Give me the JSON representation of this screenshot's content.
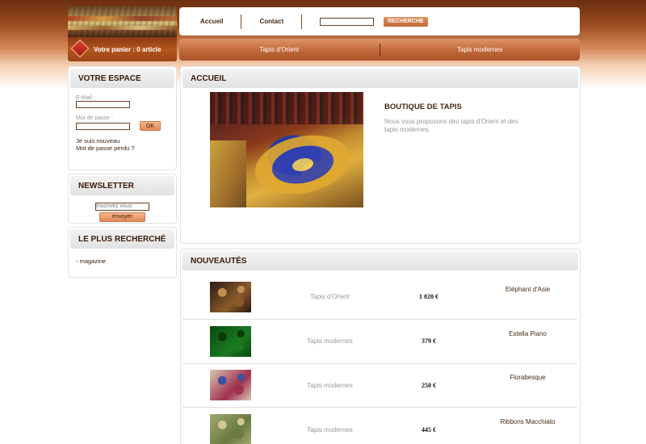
{
  "header": {
    "cart_text": "Votre panier : 0 article",
    "nav": [
      {
        "label": "Accueil"
      },
      {
        "label": "Contact"
      }
    ],
    "search": {
      "value": "",
      "button_label": "RECHERCHE"
    },
    "categories": [
      {
        "label": "Tapis d'Orient"
      },
      {
        "label": "Tapis modernes"
      }
    ]
  },
  "sidebar": {
    "espace": {
      "title": "VOTRE ESPACE",
      "email_label": "E-Mail :",
      "password_label": "Mot de passe :",
      "ok_label": "OK",
      "new_link": "Je suis nouveau",
      "lost_link": "Mot de passe perdu ?"
    },
    "newsletter": {
      "title": "NEWSLETTER",
      "placeholder": "Inscrivez vous",
      "button_label": "envoyer"
    },
    "popular": {
      "title": "LE PLUS RECHERCHÉ",
      "items": [
        "- magazine"
      ]
    }
  },
  "main": {
    "accueil": {
      "title": "ACCUEIL",
      "shop_title": "BOUTIQUE DE TAPIS",
      "shop_desc": "Nous vous proposons des tapis d'Orient et des tapis modernes."
    },
    "new": {
      "title": "NOUVEAUTÉS",
      "products": [
        {
          "category": "Tapis d'Orient",
          "price": "1 020 €",
          "name": "Eléphant d'Asie",
          "thumb_colors": [
            "#2a1a14",
            "#8a5a2a",
            "#c09050"
          ]
        },
        {
          "category": "Tapis modernes",
          "price": "379 €",
          "name": "Estella Piano",
          "thumb_colors": [
            "#0a4a10",
            "#1a7a20",
            "#0a3a08"
          ]
        },
        {
          "category": "Tapis modernes",
          "price": "250 €",
          "name": "Florabesque",
          "thumb_colors": [
            "#d8c8b0",
            "#a03050",
            "#4050a0"
          ]
        },
        {
          "category": "Tapis modernes",
          "price": "445 €",
          "name": "Ribbons Macchiato",
          "thumb_colors": [
            "#a0a870",
            "#6a7a40",
            "#d0c890"
          ]
        }
      ]
    }
  },
  "colors": {
    "brand_brown": "#6b2f10",
    "accent_orange": "#c0683a",
    "heading_text": "#3a1a08"
  }
}
